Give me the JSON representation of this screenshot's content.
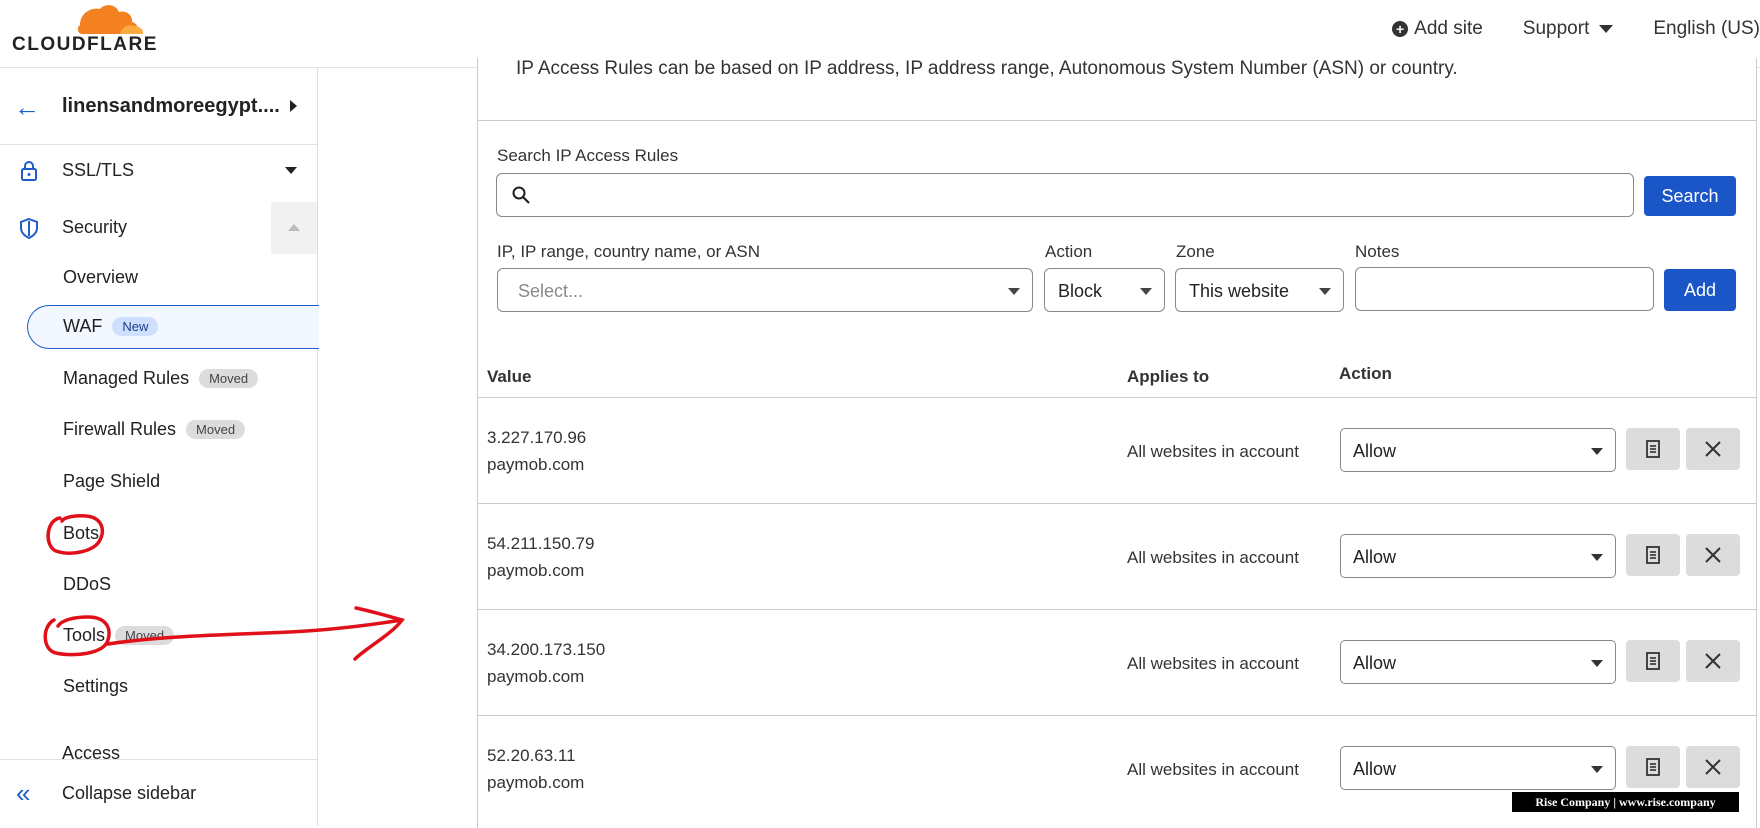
{
  "header": {
    "logo_text": "CLOUDFLARE",
    "add_site": "Add site",
    "support": "Support",
    "language": "English (US)"
  },
  "sidebar": {
    "site_name": "linensandmoreegypt....",
    "items": [
      {
        "label": "SSL/TLS"
      },
      {
        "label": "Security"
      }
    ],
    "security_sub": [
      {
        "label": "Overview",
        "badge": ""
      },
      {
        "label": "WAF",
        "badge": "New"
      },
      {
        "label": "Managed Rules",
        "badge": "Moved"
      },
      {
        "label": "Firewall Rules",
        "badge": "Moved"
      },
      {
        "label": "Page Shield",
        "badge": ""
      },
      {
        "label": "Bots",
        "badge": ""
      },
      {
        "label": "DDoS",
        "badge": ""
      },
      {
        "label": "Tools",
        "badge": "Moved"
      },
      {
        "label": "Settings",
        "badge": ""
      }
    ],
    "access": "Access",
    "collapse": "Collapse sidebar"
  },
  "main": {
    "intro": "IP Access Rules can be based on IP address, IP address range, Autonomous System Number (ASN) or country.",
    "search_label": "Search IP Access Rules",
    "search_value": "",
    "search_button": "Search",
    "form": {
      "value_label": "IP, IP range, country name, or ASN",
      "value_placeholder": "Select...",
      "action_label": "Action",
      "action_value": "Block",
      "zone_label": "Zone",
      "zone_value": "This website",
      "notes_label": "Notes",
      "notes_value": "",
      "add_button": "Add"
    },
    "table": {
      "headers": [
        "Value",
        "Applies to",
        "Action"
      ],
      "rows": [
        {
          "ip": "3.227.170.96",
          "note": "paymob.com",
          "applies": "All websites in account",
          "action": "Allow"
        },
        {
          "ip": "54.211.150.79",
          "note": "paymob.com",
          "applies": "All websites in account",
          "action": "Allow"
        },
        {
          "ip": "34.200.173.150",
          "note": "paymob.com",
          "applies": "All websites in account",
          "action": "Allow"
        },
        {
          "ip": "52.20.63.11",
          "note": "paymob.com",
          "applies": "All websites in account",
          "action": "Allow"
        }
      ]
    }
  },
  "watermark": "Rise Company | www.rise.company",
  "colors": {
    "accent": "#1a56c7",
    "logo_orange": "#f48120",
    "annotation_red": "#e0101a"
  }
}
